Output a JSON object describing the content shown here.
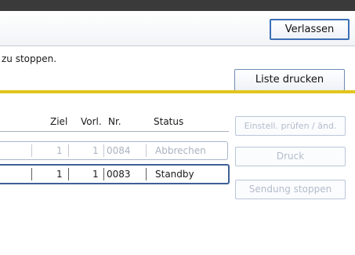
{
  "header": {
    "exit_button": "Verlassen"
  },
  "message": "zu stoppen.",
  "print_list_button": "Liste drucken",
  "table": {
    "columns": {
      "target": "Ziel",
      "pre": "Vorl.",
      "number": "Nr.",
      "status": "Status"
    },
    "rows": [
      {
        "target": "1",
        "pre": "1",
        "number": "0084",
        "status": "Abbrechen",
        "state": "inactive"
      },
      {
        "target": "1",
        "pre": "1",
        "number": "0083",
        "status": "Standby",
        "state": "selected"
      }
    ]
  },
  "side_buttons": {
    "settings": "Einstell. prüfen / änd.",
    "print": "Druck",
    "stop_sending": "Sendung stoppen"
  }
}
